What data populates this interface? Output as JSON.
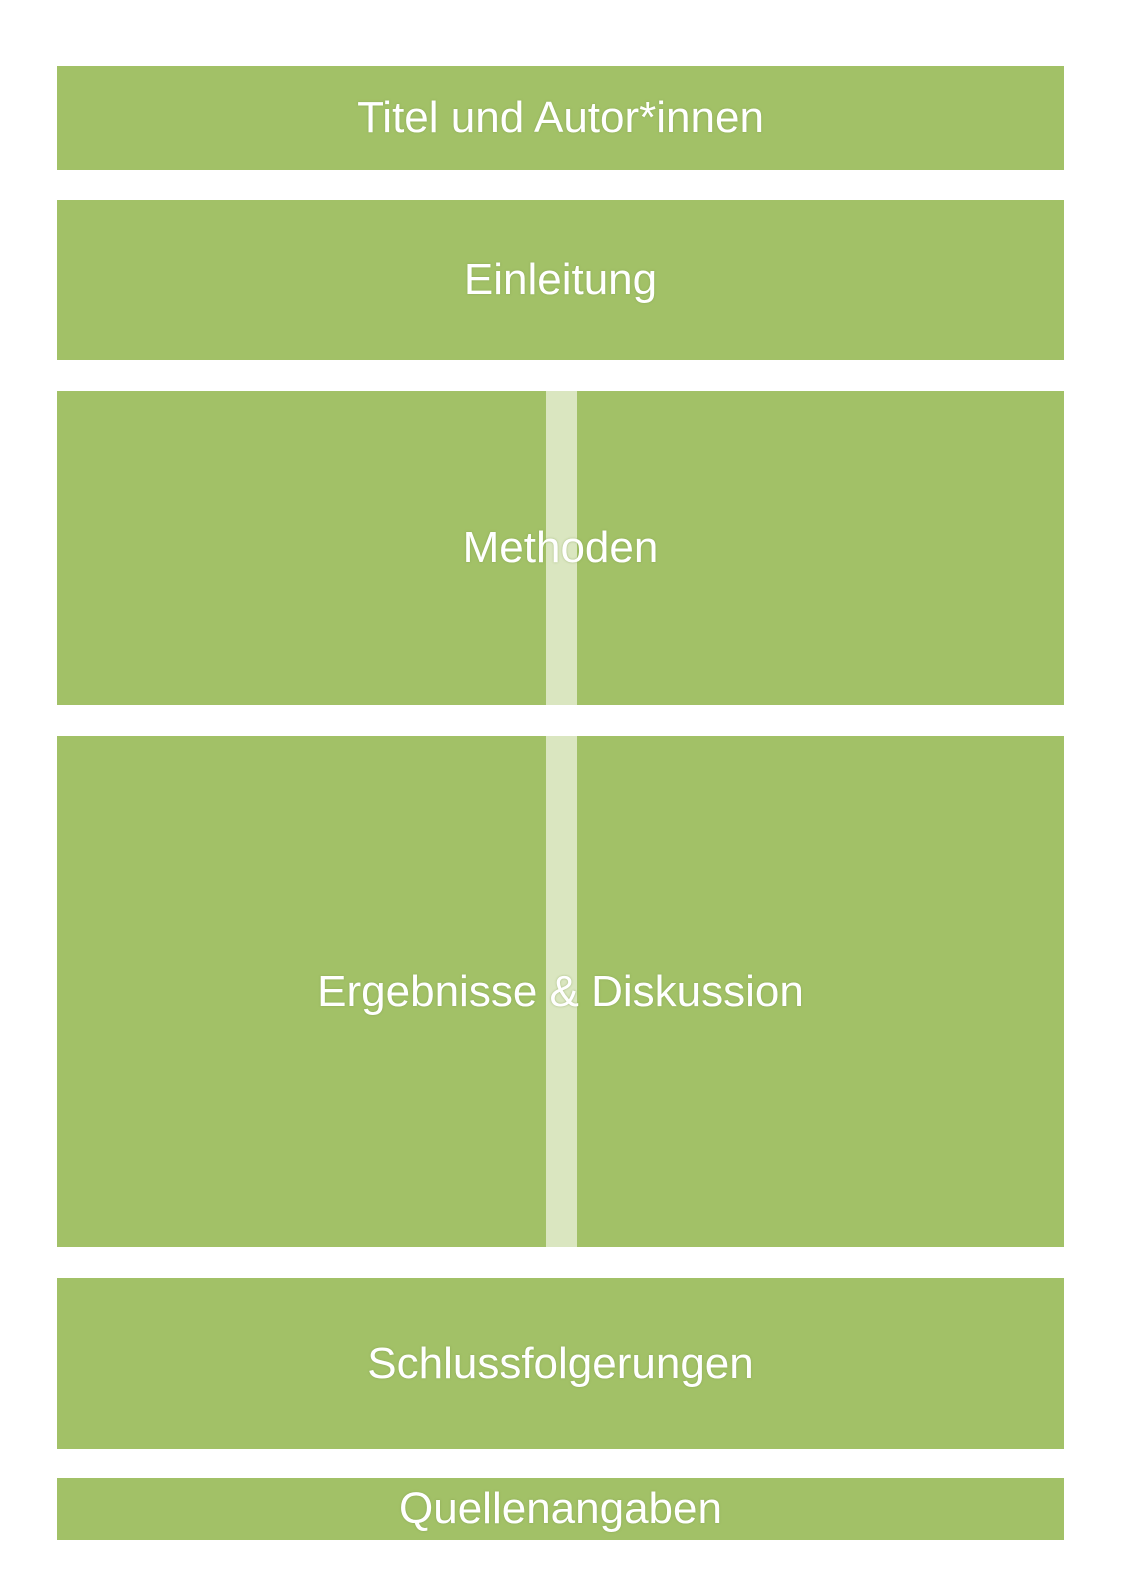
{
  "colors": {
    "section_fill": "#a2c167",
    "divider_fill": "#dae6c0",
    "label_text": "#ffffff",
    "background": "#ffffff"
  },
  "sections": {
    "title_authors": "Titel und Autor*innen",
    "introduction": "Einleitung",
    "methods": "Methoden",
    "results_discussion": "Ergebnisse & Diskussion",
    "conclusions": "Schlussfolgerungen",
    "references": "Quellenangaben"
  }
}
